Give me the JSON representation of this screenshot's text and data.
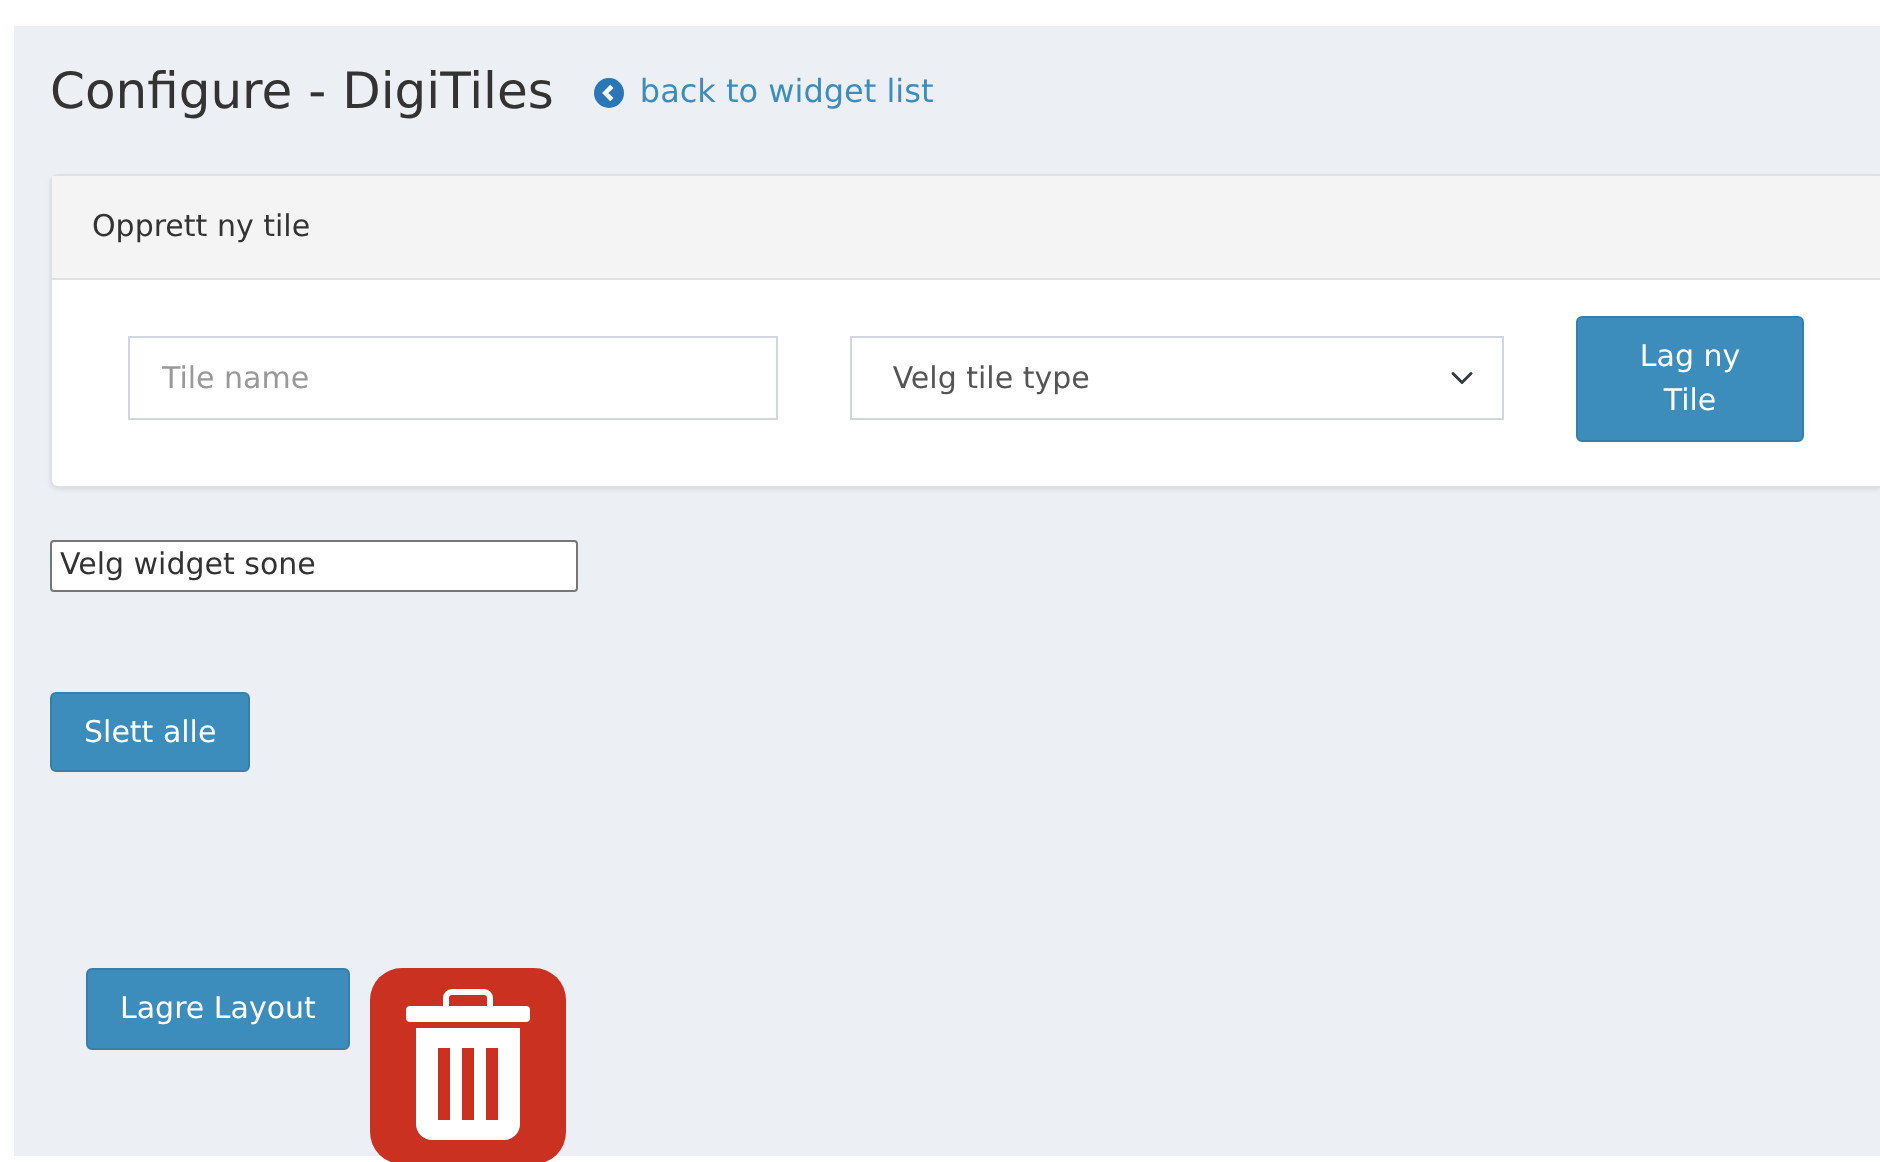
{
  "page_title": "Configure - DigiTiles",
  "back_link": "back to widget list",
  "create_card": {
    "header": "Opprett ny tile",
    "name_field": {
      "placeholder": "Tile name"
    },
    "type_select": {
      "value": "Velg tile type"
    },
    "create_button": "Lag ny Tile"
  },
  "zone_select": {
    "value": "Velg widget sone"
  },
  "delete_all_button": "Slett alle",
  "save_layout_button": "Lagre Layout"
}
